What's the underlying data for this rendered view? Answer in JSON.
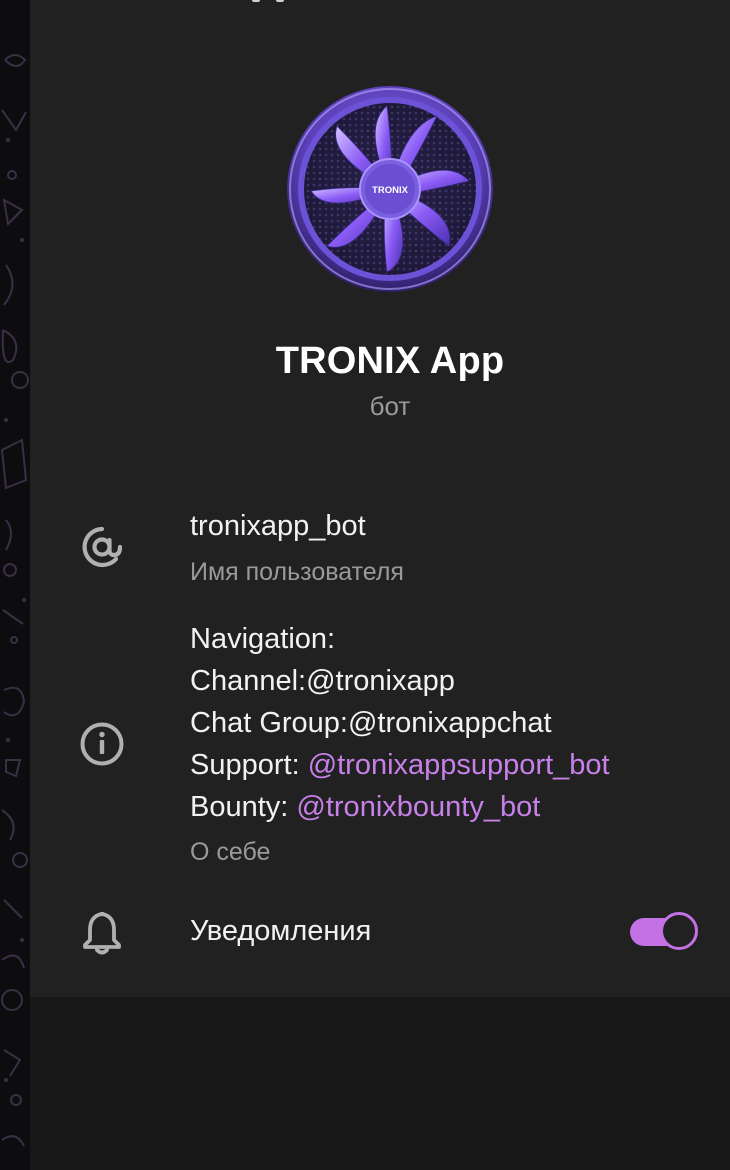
{
  "profile": {
    "name": "TRONIX App",
    "type_label": "бот",
    "avatar_text": "TRONIX"
  },
  "username_row": {
    "icon": "at-icon",
    "value": "tronixapp_bot",
    "caption": "Имя пользователя"
  },
  "bio_row": {
    "icon": "info-icon",
    "line1": "Navigation:",
    "line2": "Channel:@tronixapp",
    "line3": "Chat Group:@tronixappchat",
    "line4_prefix": "Support: ",
    "line4_link": "@tronixappsupport_bot",
    "line5_prefix": "Bounty: ",
    "line5_link": "@tronixbounty_bot",
    "caption": "О себе"
  },
  "notifications_row": {
    "icon": "bell-icon",
    "label": "Уведомления",
    "enabled": true
  },
  "colors": {
    "panel_bg": "#212121",
    "accent": "#c780e8",
    "muted_text": "#9a9a9a"
  }
}
